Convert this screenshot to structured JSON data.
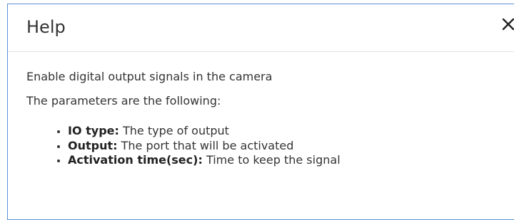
{
  "dialog": {
    "title": "Help",
    "close_icon": "close-icon",
    "paragraphs": [
      "Enable digital output signals in the camera",
      "The parameters are the following:"
    ],
    "params": [
      {
        "term": "IO type:",
        "desc": " The type of output"
      },
      {
        "term": "Output:",
        "desc": " The port that will be activated"
      },
      {
        "term": "Activation time(sec):",
        "desc": " Time to keep the signal"
      }
    ]
  },
  "colors": {
    "border": "#5b8fd6",
    "text": "#333333",
    "divider": "#e5e5e5"
  }
}
